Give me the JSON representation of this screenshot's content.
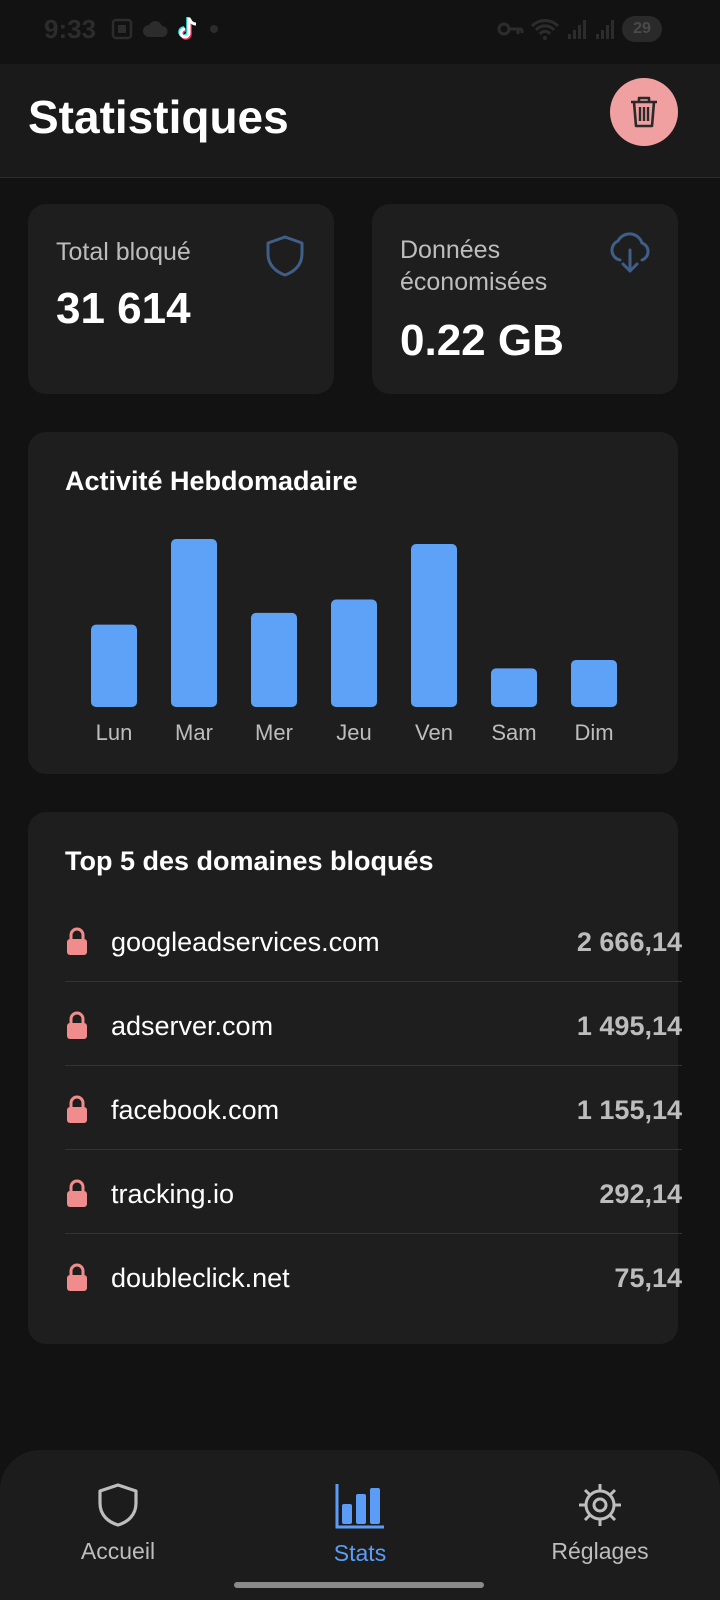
{
  "status_bar": {
    "time": "9:33",
    "battery": "29"
  },
  "header": {
    "title": "Statistiques",
    "delete_icon": "trash-icon"
  },
  "stats": {
    "total_blocked_label": "Total bloqué",
    "total_blocked_value": "31 614",
    "data_saved_label_line1": "Données",
    "data_saved_label_line2": "économisées",
    "data_saved_value": "0.22 GB"
  },
  "weekly": {
    "title": "Activité Hebdomadaire"
  },
  "chart_data": {
    "type": "bar",
    "title": "Activité Hebdomadaire",
    "categories": [
      "Lun",
      "Mar",
      "Mer",
      "Jeu",
      "Ven",
      "Sam",
      "Dim"
    ],
    "values": [
      49,
      100,
      56,
      64,
      97,
      23,
      28
    ],
    "ylim": [
      0,
      100
    ],
    "grid": false,
    "bar_color": "#5ea2f8"
  },
  "top_domains": {
    "title": "Top 5 des domaines bloqués",
    "items": [
      {
        "domain": "googleadservices.com",
        "count": "2 666,14"
      },
      {
        "domain": "adserver.com",
        "count": "1 495,14"
      },
      {
        "domain": "facebook.com",
        "count": "1 155,14"
      },
      {
        "domain": "tracking.io",
        "count": "292,14"
      },
      {
        "domain": "doubleclick.net",
        "count": "75,14"
      }
    ]
  },
  "nav": {
    "home_label": "Accueil",
    "stats_label": "Stats",
    "settings_label": "Réglages",
    "active": "Stats"
  },
  "colors": {
    "accent": "#5b9cf6",
    "danger": "#f0a0a0",
    "card": "#1e1e1e",
    "background": "#121212"
  }
}
